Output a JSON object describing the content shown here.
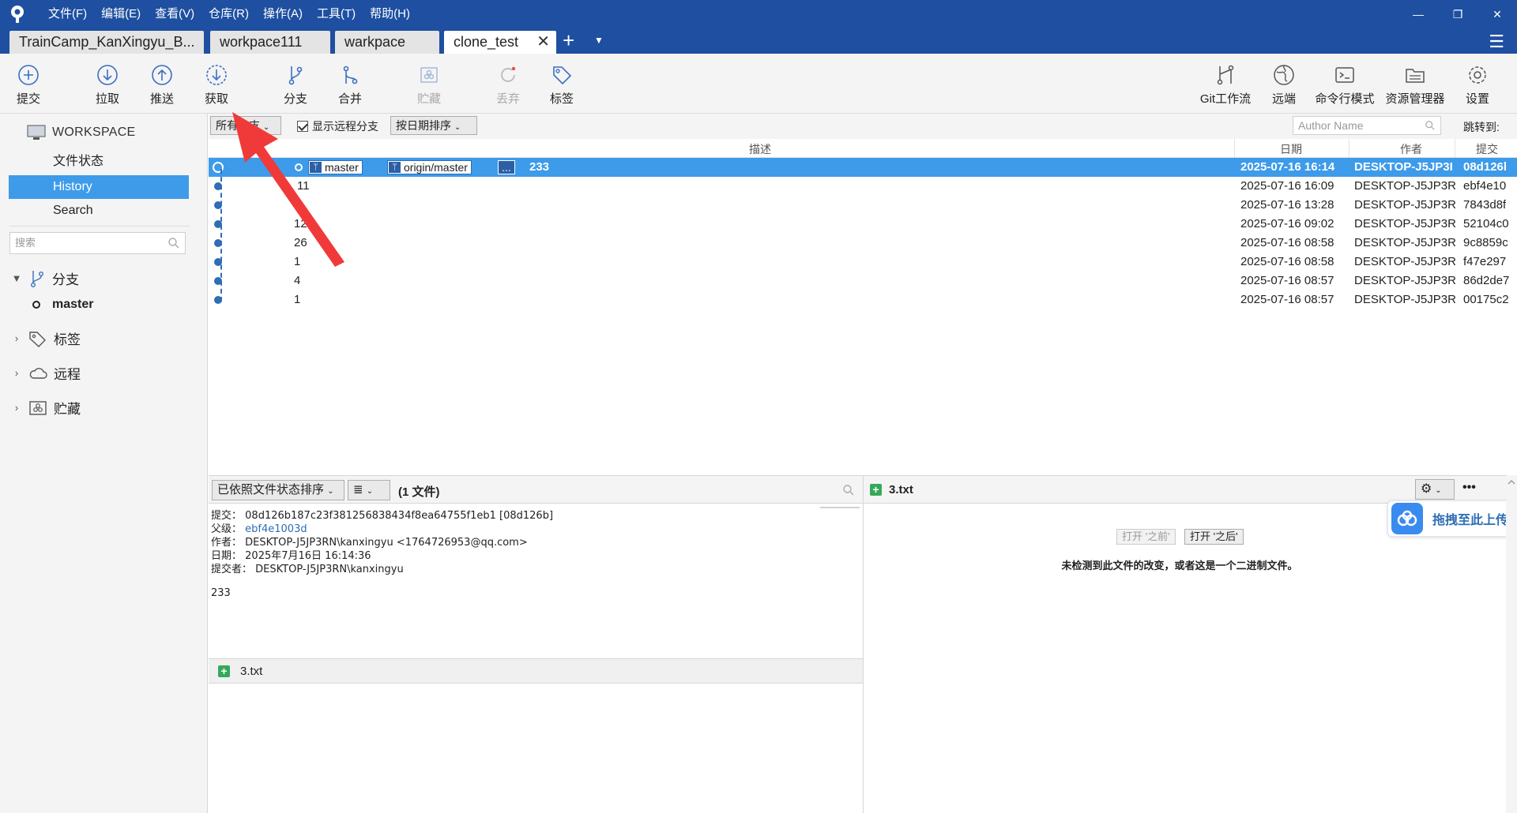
{
  "titlebar": {
    "menu": [
      "文件(F)",
      "编辑(E)",
      "查看(V)",
      "仓库(R)",
      "操作(A)",
      "工具(T)",
      "帮助(H)"
    ],
    "minimize": "—",
    "maximize": "❐",
    "close": "✕"
  },
  "tabs": [
    {
      "label": "TrainCamp_KanXingyu_B..."
    },
    {
      "label": "workpace111"
    },
    {
      "label": "warkpace"
    },
    {
      "label": "clone_test"
    }
  ],
  "tab_close": "✕",
  "tab_add": "+",
  "tab_dropdown": "▼",
  "tab_menu": "☰",
  "toolbar": {
    "commit": "提交",
    "pull": "拉取",
    "push": "推送",
    "fetch": "获取",
    "branch": "分支",
    "merge": "合并",
    "stash": "贮藏",
    "discard": "丢弃",
    "tag": "标签",
    "git_flow": "Git工作流",
    "remote": "远端",
    "terminal": "命令行模式",
    "explorer": "资源管理器",
    "settings": "设置"
  },
  "sidebar": {
    "workspace": "WORKSPACE",
    "items": [
      "文件状态",
      "History",
      "Search"
    ],
    "search_placeholder": "搜索",
    "branches": "分支",
    "branch_master": "master",
    "tags": "标签",
    "remotes": "远程",
    "stashes": "贮藏"
  },
  "filters": {
    "branch_filter": "所有分支",
    "show_remote": "显示远程分支",
    "sort": "按日期排序",
    "author_placeholder": "Author Name",
    "jump_to": "跳转到:"
  },
  "table": {
    "headers": {
      "description": "描述",
      "date": "日期",
      "author": "作者",
      "commit": "提交"
    },
    "rows": [
      {
        "desc": "233",
        "date": "2025-07-16 16:14",
        "author": "DESKTOP-J5JP3I",
        "hash": "08d126l"
      },
      {
        "desc": "11",
        "date": "2025-07-16 16:09",
        "author": "DESKTOP-J5JP3R",
        "hash": "ebf4e10"
      },
      {
        "desc": "3",
        "date": "2025-07-16 13:28",
        "author": "DESKTOP-J5JP3R",
        "hash": "7843d8f"
      },
      {
        "desc": "123",
        "date": "2025-07-16 09:02",
        "author": "DESKTOP-J5JP3R",
        "hash": "52104c0"
      },
      {
        "desc": "26",
        "date": "2025-07-16 08:58",
        "author": "DESKTOP-J5JP3R",
        "hash": "9c8859c"
      },
      {
        "desc": "1",
        "date": "2025-07-16 08:58",
        "author": "DESKTOP-J5JP3R",
        "hash": "f47e297"
      },
      {
        "desc": "4",
        "date": "2025-07-16 08:57",
        "author": "DESKTOP-J5JP3R",
        "hash": "86d2de7"
      },
      {
        "desc": "1",
        "date": "2025-07-16 08:57",
        "author": "DESKTOP-J5JP3R",
        "hash": "00175c2"
      }
    ],
    "refs": {
      "local": "master",
      "remote": "origin/master",
      "more": "..."
    }
  },
  "details": {
    "sort_dropdown": "已依照文件状态排序",
    "view_dropdown": "≣",
    "file_count": "(1 文件)",
    "commit_label": "提交：",
    "commit_value": "08d126b187c23f381256838434f8ea64755f1eb1 [08d126b]",
    "parent_label": "父级：",
    "parent_value": "ebf4e1003d",
    "author_label": "作者：",
    "author_value": "DESKTOP-J5JP3RN\\kanxingyu <1764726953@qq.com>",
    "date_label": "日期：",
    "date_value": "2025年7月16日 16:14:36",
    "committer_label": "提交者：",
    "committer_value": "DESKTOP-J5JP3RN\\kanxingyu",
    "message": "233",
    "file_name": "3.txt"
  },
  "diff": {
    "file_name": "3.txt",
    "open_before": "打开 '之前'",
    "open_after": "打开 '之后'",
    "message": "未检测到此文件的改变，或者这是一个二进制文件。",
    "more": "•••"
  },
  "upload": {
    "label": "拖拽至此上传"
  }
}
